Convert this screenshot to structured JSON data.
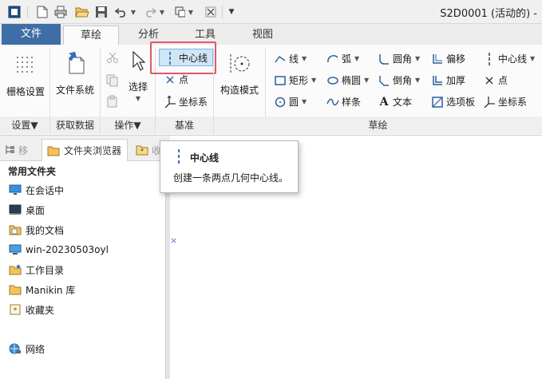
{
  "window": {
    "title": "S2D0001 (活动的) -"
  },
  "quick_access": {
    "icons": [
      "app-icon",
      "new-icon",
      "print-icon",
      "open-icon",
      "save-icon",
      "undo-icon",
      "redo-icon",
      "regenerate-icon",
      "close-window-icon",
      "customize-icon"
    ]
  },
  "tabs": [
    {
      "label": "文件"
    },
    {
      "label": "草绘"
    },
    {
      "label": "分析"
    },
    {
      "label": "工具"
    },
    {
      "label": "视图"
    }
  ],
  "ribbon": {
    "settings": {
      "grid_label": "栅格设置",
      "footer": "设置▼"
    },
    "get_data": {
      "file_system_label": "文件系统",
      "footer": "获取数据"
    },
    "operations": {
      "select_label": "选择",
      "footer": "操作▼"
    },
    "datum": {
      "centerline_label": "中心线",
      "point_label": "点",
      "csys_label": "坐标系",
      "footer": "基准"
    },
    "sketch": {
      "construction_label": "构造模式",
      "line_label": "线",
      "rectangle_label": "矩形",
      "circle_label": "圆",
      "arc_label": "弧",
      "ellipse_label": "椭圆",
      "spline_label": "样条",
      "fillet_label": "圆角",
      "chamfer_label": "倒角",
      "text_label": "文本",
      "offset_label": "偏移",
      "thicken_label": "加厚",
      "palette_label": "选项板",
      "centerline2_label": "中心线",
      "point2_label": "点",
      "csys2_label": "坐标系",
      "footer": "草绘"
    }
  },
  "left_panel": {
    "tabs": [
      {
        "label": "移"
      },
      {
        "label": "文件夹浏览器"
      },
      {
        "label": "收"
      }
    ],
    "heading": "常用文件夹",
    "items": [
      {
        "label": "在会话中"
      },
      {
        "label": "桌面"
      },
      {
        "label": "我的文档"
      },
      {
        "label": "win-20230503oyl"
      },
      {
        "label": "工作目录"
      },
      {
        "label": "Manikin 库"
      },
      {
        "label": "收藏夹"
      },
      {
        "label": "网络"
      }
    ]
  },
  "tooltip": {
    "title": "中心线",
    "description": "创建一条两点几何中心线。"
  },
  "colors": {
    "file_tab": "#3f6ea7",
    "highlight_border": "#e0576c",
    "accent": "#2c5f9e"
  }
}
